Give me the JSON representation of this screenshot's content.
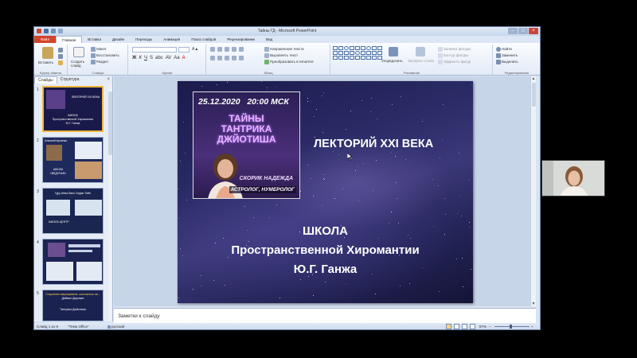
{
  "window": {
    "title": "Тайны ГД - Microsoft PowerPoint"
  },
  "tabs": [
    "Файл",
    "Главная",
    "Вставка",
    "Дизайн",
    "Переходы",
    "Анимация",
    "Показ слайдов",
    "Рецензирование",
    "Вид"
  ],
  "ribbon": {
    "clipboard": {
      "paste": "Вставить",
      "name": "Буфер обмена"
    },
    "slides": {
      "new_slide": "Создать слайд",
      "layout": "Макет",
      "reset": "Восстановить",
      "section": "Раздел",
      "name": "Слайды"
    },
    "font": {
      "name": "Шрифт"
    },
    "paragraph": {
      "text_direction": "Направление текста",
      "align_text": "Выровнять текст",
      "convert": "Преобразовать в SmartArt",
      "name": "Абзац"
    },
    "drawing": {
      "arrange": "Упорядочить",
      "quick_styles": "Экспресс-стили",
      "fill": "Заливка фигуры",
      "outline": "Контур фигуры",
      "effects": "Эффекты фигур",
      "name": "Рисование"
    },
    "editing": {
      "find": "Найти",
      "replace": "Заменить",
      "select": "Выделить",
      "name": "Редактирование"
    }
  },
  "left_pane": {
    "tabs": [
      "Слайды",
      "Структура"
    ],
    "thumbnails": [
      {
        "number": "1",
        "lines": [
          "ЛЕКТОРИЙ XXI ВЕКА",
          "ШКОЛА",
          "Пространственной Хиромантии",
          "Ю.Г. Ганжа"
        ]
      },
      {
        "number": "2",
        "lines": [
          "Алексей Ирченко",
          "ШКОЛА",
          "«ВЕДУНЬЯ»"
        ]
      },
      {
        "number": "3",
        "lines": [
          "Гуру Инна Вэнс Седан Тейн",
          "ШКОЛА ЦЕНТР"
        ]
      },
      {
        "number": "4",
        "lines": []
      },
      {
        "number": "5",
        "lines": [
          "Стороннее мероприятие, состоялось на...",
          "Даймон Джулиан",
          "Тантрика Джйотиша"
        ]
      }
    ]
  },
  "slide": {
    "poster": {
      "date": "25.12.2020",
      "time": "20:00 МСК",
      "title_lines": [
        "ТАЙНЫ",
        "ТАНТРИКА",
        "ДЖЙОТИША"
      ],
      "name": "СКОРИК НАДЕЖДА",
      "role": "АСТРОЛОГ, НУМЕРОЛОГ"
    },
    "lectorium": "ЛЕКТОРИЙ XXI ВЕКА",
    "school_lines": [
      "ШКОЛА",
      "Пространственной Хиромантии",
      "Ю.Г. Ганжа"
    ]
  },
  "notes": {
    "placeholder": "Заметки к слайду"
  },
  "status": {
    "slide_info": "Слайд 1 из 9",
    "theme": "\"Тема Office\"",
    "language": "русский",
    "zoom": "87%"
  },
  "colors": {
    "file_tab": "#d2452b",
    "slide_bg": "#2a2a66",
    "poster_title": "#e7b4ff",
    "selected_thumb_border": "#f0b640"
  }
}
